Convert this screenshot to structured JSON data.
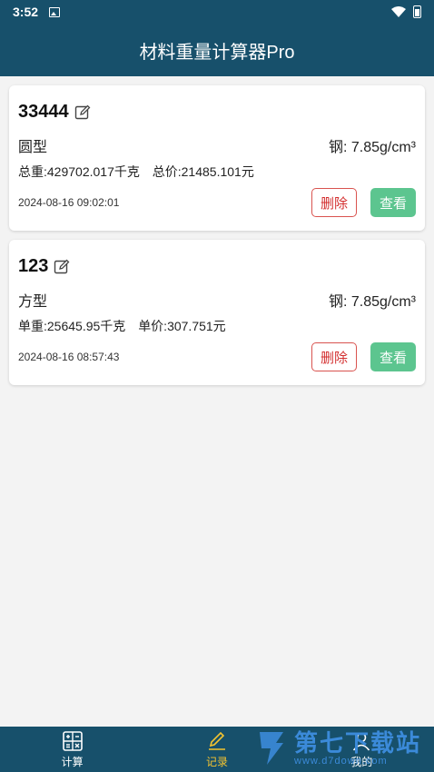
{
  "status_bar": {
    "time": "3:52"
  },
  "app_title": "材料重量计算器Pro",
  "records": [
    {
      "name": "33444",
      "shape": "圆型",
      "material": "钢: 7.85g/cm³",
      "weight": "总重:429702.017千克",
      "price": "总价:21485.101元",
      "date": "2024-08-16 09:02:01",
      "delete_label": "删除",
      "view_label": "查看"
    },
    {
      "name": "123",
      "shape": "方型",
      "material": "钢: 7.85g/cm³",
      "weight": "单重:25645.95千克",
      "price": "单价:307.751元",
      "date": "2024-08-16 08:57:43",
      "delete_label": "删除",
      "view_label": "查看"
    }
  ],
  "bottom_nav": [
    {
      "label": "计算",
      "icon": "calculator-icon",
      "active": false
    },
    {
      "label": "记录",
      "icon": "pencil-icon",
      "active": true
    },
    {
      "label": "我的",
      "icon": "person-icon",
      "active": false
    }
  ],
  "watermark": {
    "main": "第七下载站",
    "sub": "www.d7down.com"
  },
  "colors": {
    "primary": "#17506b",
    "active_tab": "#f4c430",
    "delete": "#d32f2f",
    "view": "#5cc58f",
    "background": "#f3f3f3"
  }
}
